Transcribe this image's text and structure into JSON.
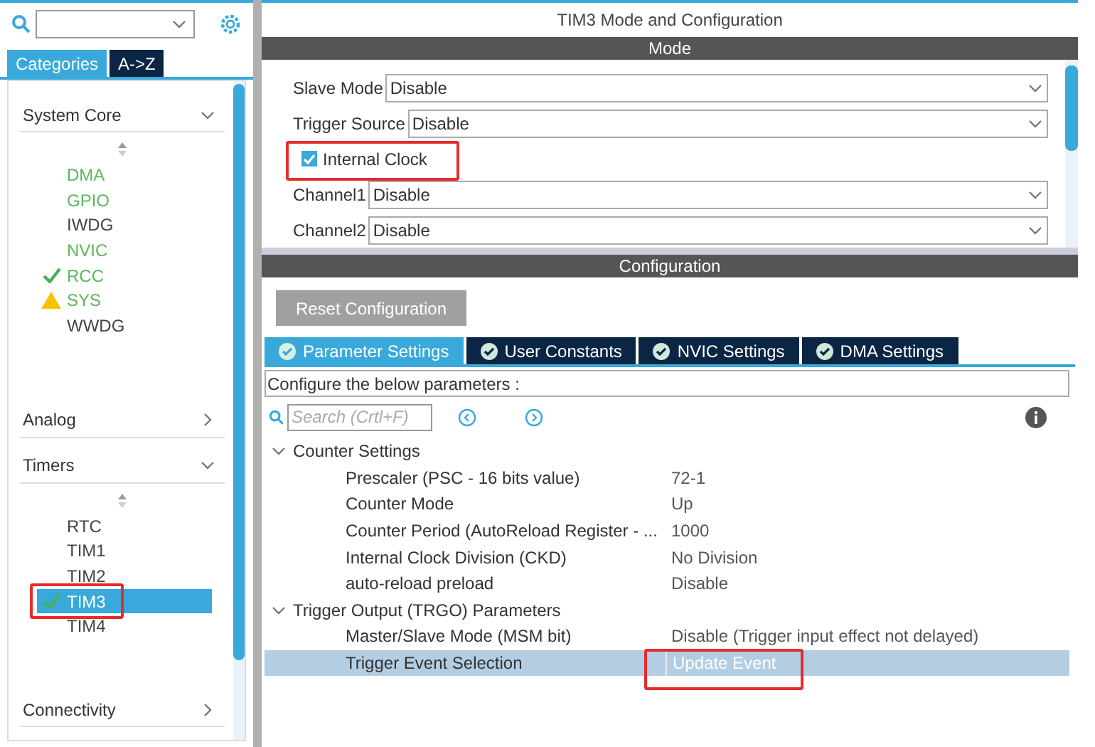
{
  "sidebar": {
    "tabs": [
      {
        "label": "Categories",
        "selected": true
      },
      {
        "label": "A->Z",
        "selected": false
      }
    ],
    "groups": [
      {
        "title": "System Core",
        "expanded": true,
        "items": [
          {
            "label": "DMA",
            "kind": "plain",
            "enabled": true,
            "selected": false,
            "highlighted": false
          },
          {
            "label": "GPIO",
            "kind": "plain",
            "enabled": true,
            "selected": false,
            "highlighted": false
          },
          {
            "label": "IWDG",
            "kind": "plain",
            "enabled": false,
            "selected": false,
            "highlighted": false
          },
          {
            "label": "NVIC",
            "kind": "plain",
            "enabled": true,
            "selected": false,
            "highlighted": false
          },
          {
            "label": "RCC",
            "kind": "ok",
            "enabled": true,
            "selected": false,
            "highlighted": false
          },
          {
            "label": "SYS",
            "kind": "warning",
            "enabled": true,
            "selected": false,
            "highlighted": false
          },
          {
            "label": "WWDG",
            "kind": "plain",
            "enabled": false,
            "selected": false,
            "highlighted": false
          }
        ]
      },
      {
        "title": "Analog",
        "expanded": false
      },
      {
        "title": "Timers",
        "expanded": true,
        "items": [
          {
            "label": "RTC",
            "kind": "plain",
            "enabled": false,
            "selected": false,
            "highlighted": false
          },
          {
            "label": "TIM1",
            "kind": "plain",
            "enabled": false,
            "selected": false,
            "highlighted": false
          },
          {
            "label": "TIM2",
            "kind": "plain",
            "enabled": false,
            "selected": false,
            "highlighted": false
          },
          {
            "label": "TIM3",
            "kind": "ok",
            "enabled": true,
            "selected": true,
            "highlighted": true
          },
          {
            "label": "TIM4",
            "kind": "plain",
            "enabled": false,
            "selected": false,
            "highlighted": false
          }
        ]
      },
      {
        "title": "Connectivity",
        "expanded": false
      }
    ]
  },
  "main": {
    "title": "TIM3 Mode and Configuration",
    "mode": {
      "header": "Mode",
      "rows": [
        {
          "kind": "select",
          "label": "Slave Mode",
          "value": "Disable"
        },
        {
          "kind": "select",
          "label": "Trigger Source",
          "value": "Disable"
        },
        {
          "kind": "checkbox",
          "label": "Internal Clock",
          "checked": true,
          "highlighted": true
        },
        {
          "kind": "select",
          "label": "Channel1",
          "value": "Disable"
        },
        {
          "kind": "select",
          "label": "Channel2",
          "value": "Disable"
        }
      ]
    },
    "configuration": {
      "header": "Configuration",
      "reset_button": "Reset Configuration",
      "tabs": [
        {
          "label": "Parameter Settings",
          "selected": true
        },
        {
          "label": "User Constants",
          "selected": false
        },
        {
          "label": "NVIC Settings",
          "selected": false
        },
        {
          "label": "DMA Settings",
          "selected": false
        }
      ],
      "description": "Configure the below parameters :",
      "search": {
        "placeholder": "Search (Crtl+F)"
      },
      "groups": [
        {
          "title": "Counter Settings",
          "expanded": true,
          "params": [
            {
              "name": "Prescaler (PSC - 16 bits value)",
              "value": "72-1",
              "selected": false,
              "highlighted": false
            },
            {
              "name": "Counter Mode",
              "value": "Up",
              "selected": false,
              "highlighted": false
            },
            {
              "name": "Counter Period (AutoReload Register - ...",
              "value": "1000",
              "selected": false,
              "highlighted": false
            },
            {
              "name": "Internal Clock Division (CKD)",
              "value": "No Division",
              "selected": false,
              "highlighted": false
            },
            {
              "name": "auto-reload preload",
              "value": "Disable",
              "selected": false,
              "highlighted": false
            }
          ]
        },
        {
          "title": "Trigger Output (TRGO) Parameters",
          "expanded": true,
          "params": [
            {
              "name": "Master/Slave Mode (MSM bit)",
              "value": "Disable (Trigger input effect not delayed)",
              "selected": false,
              "highlighted": false
            },
            {
              "name": "Trigger Event Selection",
              "value": "Update Event",
              "selected": true,
              "highlighted": true
            }
          ]
        }
      ]
    }
  }
}
